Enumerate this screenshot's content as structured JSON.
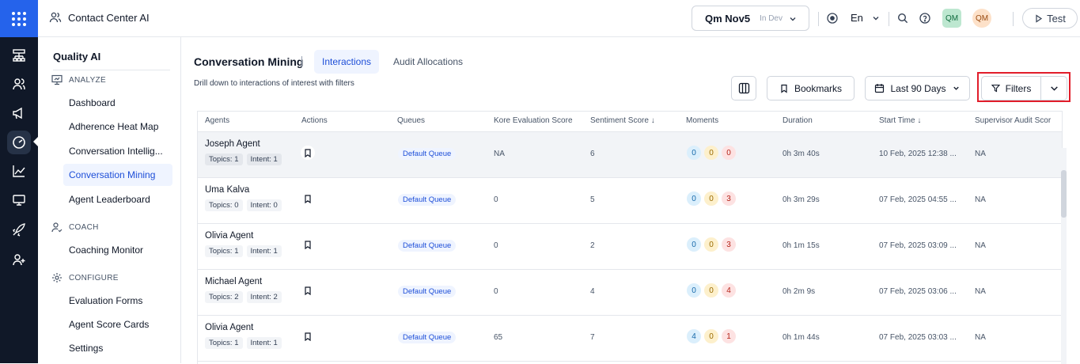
{
  "header": {
    "app_title": "Contact Center AI",
    "env": {
      "name": "Qm Nov5",
      "status": "In Dev"
    },
    "language": "En",
    "avatar1": "QM",
    "avatar2": "QM",
    "test_label": "Test"
  },
  "rail_icons": [
    "sitemap-icon",
    "users-icon",
    "megaphone-icon",
    "gauge-icon",
    "line-chart-icon",
    "monitor-icon",
    "rocket-icon",
    "user-plus-icon"
  ],
  "sidebar": {
    "title": "Quality AI",
    "sections": {
      "analyze": "ANALYZE",
      "coach": "COACH",
      "configure": "CONFIGURE"
    },
    "items": [
      {
        "label": "Dashboard"
      },
      {
        "label": "Adherence Heat Map"
      },
      {
        "label": "Conversation Intellig..."
      },
      {
        "label": "Conversation Mining"
      },
      {
        "label": "Agent Leaderboard"
      },
      {
        "label": "Coaching Monitor"
      },
      {
        "label": "Evaluation Forms"
      },
      {
        "label": "Agent Score Cards"
      },
      {
        "label": "Settings"
      }
    ]
  },
  "main": {
    "title": "Conversation Mining",
    "tabs": [
      {
        "label": "Interactions"
      },
      {
        "label": "Audit Allocations"
      }
    ],
    "description": "Drill down to interactions of interest with filters",
    "bookmarks_label": "Bookmarks",
    "date_range": "Last 90 Days",
    "filters_label": "Filters"
  },
  "table": {
    "columns": [
      "Agents",
      "Actions",
      "Queues",
      "Kore Evaluation Score",
      "Sentiment Score ↓",
      "Moments",
      "Duration",
      "Start Time ↓",
      "Supervisor Audit Scor"
    ],
    "rows": [
      {
        "agent": "Joseph Agent",
        "topics": "Topics: 1",
        "intent": "Intent: 1",
        "queue": "Default Queue",
        "kore": "NA",
        "sentiment": "6",
        "m1": "0",
        "m2": "0",
        "m3": "0",
        "duration": "0h 3m 40s",
        "start": "10 Feb, 2025 12:38 ...",
        "audit": "NA"
      },
      {
        "agent": "Uma Kalva",
        "topics": "Topics: 0",
        "intent": "Intent: 0",
        "queue": "Default Queue",
        "kore": "0",
        "sentiment": "5",
        "m1": "0",
        "m2": "0",
        "m3": "3",
        "duration": "0h 3m 29s",
        "start": "07 Feb, 2025 04:55 ...",
        "audit": "NA"
      },
      {
        "agent": "Olivia Agent",
        "topics": "Topics: 1",
        "intent": "Intent: 1",
        "queue": "Default Queue",
        "kore": "0",
        "sentiment": "2",
        "m1": "0",
        "m2": "0",
        "m3": "3",
        "duration": "0h 1m 15s",
        "start": "07 Feb, 2025 03:09 ...",
        "audit": "NA"
      },
      {
        "agent": "Michael Agent",
        "topics": "Topics: 2",
        "intent": "Intent: 2",
        "queue": "Default Queue",
        "kore": "0",
        "sentiment": "4",
        "m1": "0",
        "m2": "0",
        "m3": "4",
        "duration": "0h 2m 9s",
        "start": "07 Feb, 2025 03:06 ...",
        "audit": "NA"
      },
      {
        "agent": "Olivia Agent",
        "topics": "Topics: 1",
        "intent": "Intent: 1",
        "queue": "Default Queue",
        "kore": "65",
        "sentiment": "7",
        "m1": "4",
        "m2": "0",
        "m3": "1",
        "duration": "0h 1m 44s",
        "start": "07 Feb, 2025 03:03 ...",
        "audit": "NA"
      }
    ]
  }
}
